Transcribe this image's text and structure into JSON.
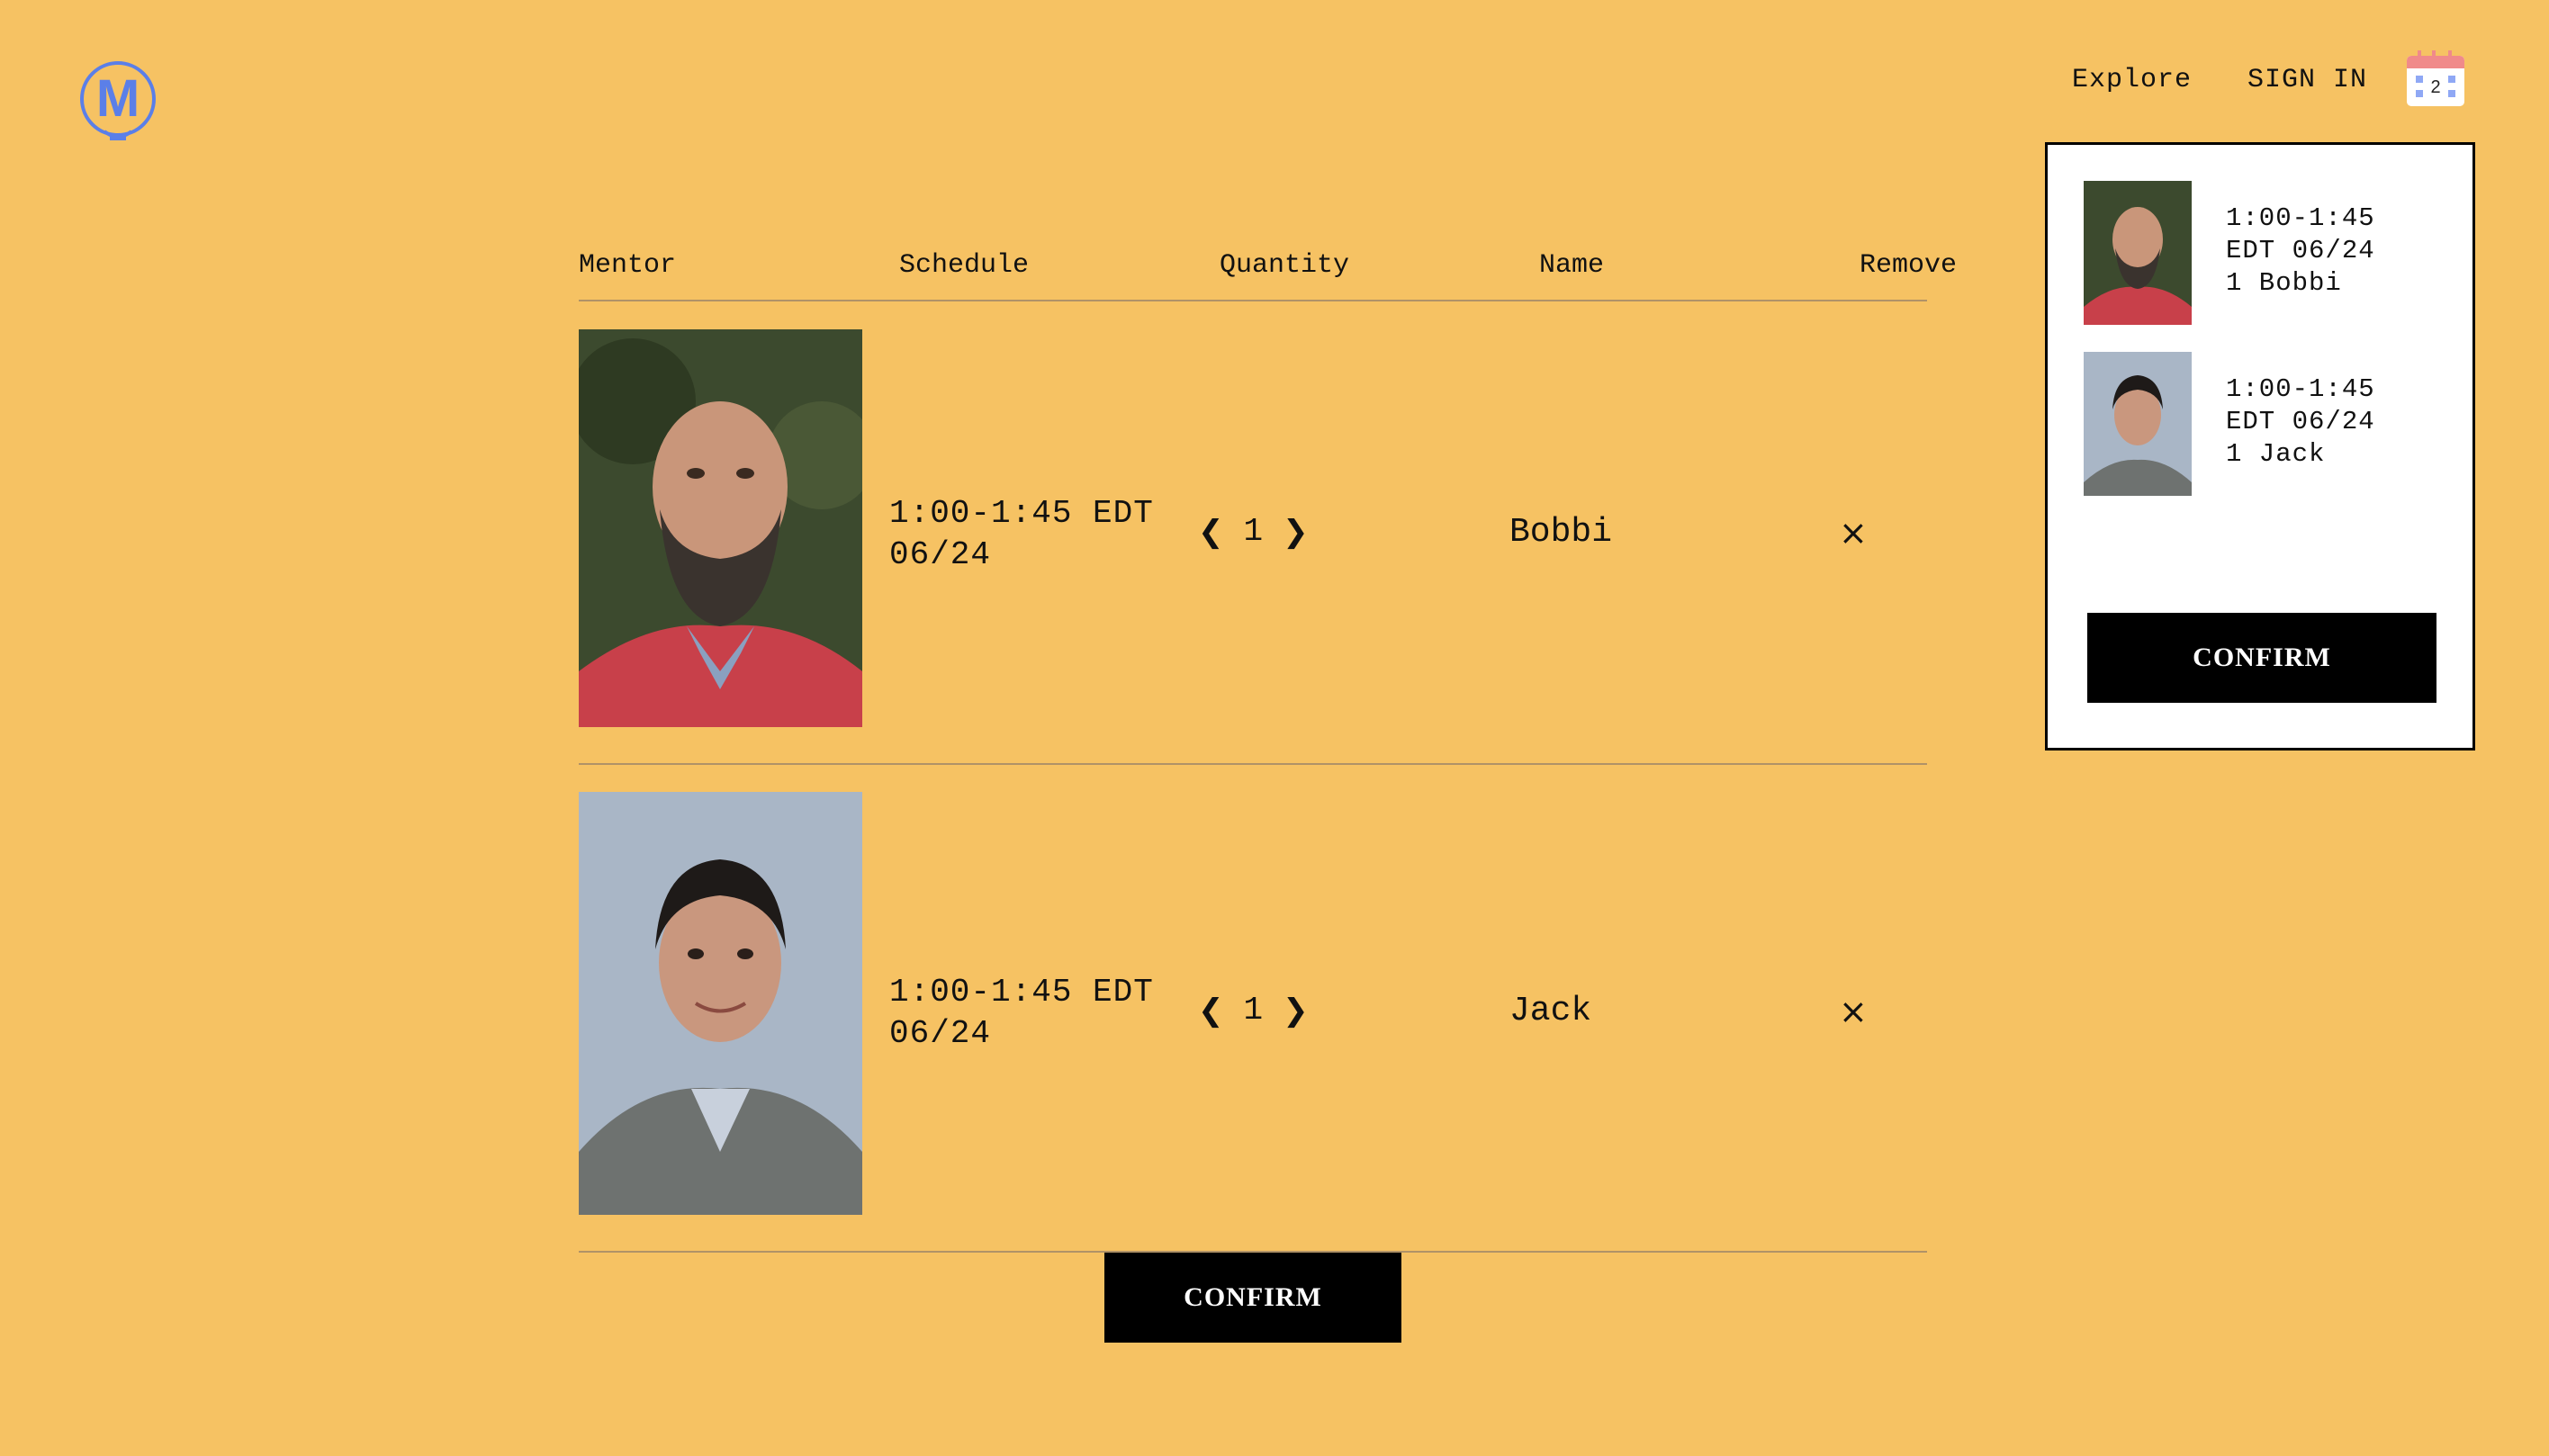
{
  "nav": {
    "logo_letter": "M",
    "explore": "Explore",
    "sign_in": "SIGN IN",
    "cart_count": "2"
  },
  "table": {
    "headers": {
      "mentor": "Mentor",
      "schedule": "Schedule",
      "quantity": "Quantity",
      "name": "Name",
      "remove": "Remove"
    },
    "rows": [
      {
        "schedule_line1": "1:00-1:45 EDT",
        "schedule_line2": "06/24",
        "quantity": "1",
        "name": "Bobbi",
        "remove": "×"
      },
      {
        "schedule_line1": "1:00-1:45 EDT",
        "schedule_line2": "06/24",
        "quantity": "1",
        "name": "Jack",
        "remove": "×"
      }
    ],
    "qty_prev": "❮",
    "qty_next": "❯"
  },
  "confirm_label": "CONFIRM",
  "cart": {
    "items": [
      {
        "line1": "1:00-1:45",
        "line2": "EDT 06/24",
        "line3": "1 Bobbi"
      },
      {
        "line1": "1:00-1:45",
        "line2": "EDT 06/24",
        "line3": "1 Jack"
      }
    ],
    "confirm_label": "CONFIRM"
  },
  "colors": {
    "background": "#F6C263",
    "accent": "#5B7FE8",
    "button": "#000000"
  },
  "icons": [
    "logo-bulb-icon",
    "calendar-icon",
    "chevron-left-icon",
    "chevron-right-icon",
    "close-icon"
  ]
}
